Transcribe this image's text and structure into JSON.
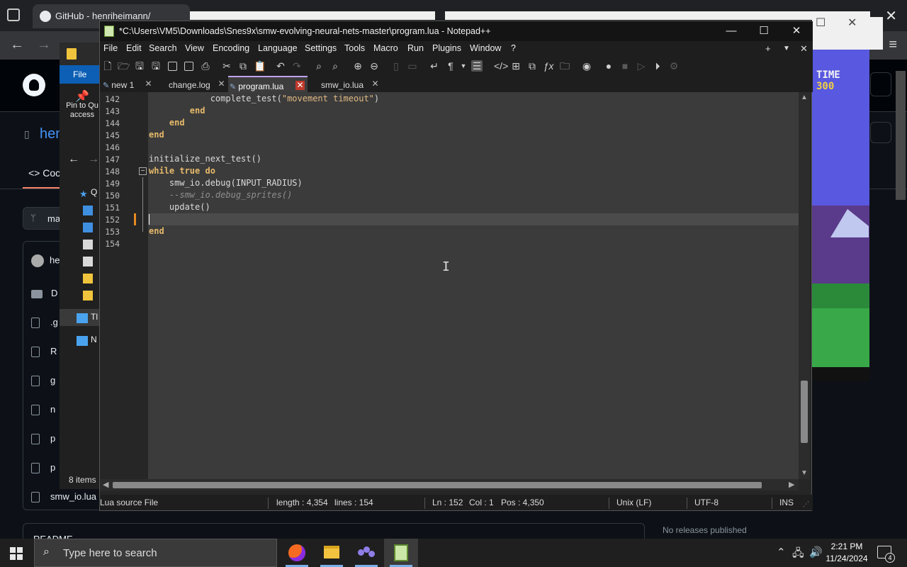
{
  "browser": {
    "tab_title": "GitHub - henriheimann/",
    "repo_name": "hen",
    "code_tab": "Code",
    "code_tab_visible": "Coc",
    "branch": "ma",
    "owner_avatar_text": "he",
    "files": [
      {
        "name": "D",
        "type": "folder"
      },
      {
        "name": ".g",
        "type": "file"
      },
      {
        "name": "R",
        "type": "file"
      },
      {
        "name": "g",
        "type": "file"
      },
      {
        "name": "n",
        "type": "file"
      },
      {
        "name": "p",
        "type": "file"
      },
      {
        "name": "p",
        "type": "file"
      },
      {
        "name": "smw_io.lua",
        "type": "file"
      }
    ],
    "readme_label": "README",
    "releases_text": "No releases published"
  },
  "explorer": {
    "ribbon_file_tab": "File",
    "pin_label_line1": "Pin to Qu",
    "pin_label_line2": "access",
    "nav_items": [
      {
        "label": "Q",
        "icon": "star-icon",
        "color": "#4aa3ef"
      },
      {
        "label": "",
        "icon": "desktop-icon",
        "color": "#3f8fe0"
      },
      {
        "label": "",
        "icon": "downloads-icon",
        "color": "#3f8fe0"
      },
      {
        "label": "",
        "icon": "documents-icon",
        "color": "#d8d8d8"
      },
      {
        "label": "",
        "icon": "pictures-icon",
        "color": "#d8d8d8"
      },
      {
        "label": "",
        "icon": "folder-icon",
        "color": "#f0c43c"
      },
      {
        "label": "",
        "icon": "folder-icon",
        "color": "#f0c43c"
      },
      {
        "label": "Tl",
        "icon": "this-pc-icon",
        "color": "#4aa3ef"
      },
      {
        "label": "N",
        "icon": "network-icon",
        "color": "#4aa3ef"
      }
    ],
    "status": "8 items"
  },
  "emulator": {
    "hud_line1": "TIME",
    "hud_line2": "300"
  },
  "npp": {
    "title": "*C:\\Users\\VM5\\Downloads\\Snes9x\\smw-evolving-neural-nets-master\\program.lua - Notepad++",
    "menu": [
      "File",
      "Edit",
      "Search",
      "View",
      "Encoding",
      "Language",
      "Settings",
      "Tools",
      "Macro",
      "Run",
      "Plugins",
      "Window",
      "?"
    ],
    "tabs": [
      {
        "label": "new 1",
        "active": false
      },
      {
        "label": "change.log",
        "active": false
      },
      {
        "label": "program.lua",
        "active": true
      },
      {
        "label": "smw_io.lua",
        "active": false
      }
    ],
    "lines": [
      {
        "num": "142",
        "indent": "            ",
        "parts": [
          {
            "t": "complete_test(",
            "c": ""
          },
          {
            "t": "\"movement timeout\"",
            "c": "str"
          },
          {
            "t": ")",
            "c": ""
          }
        ]
      },
      {
        "num": "143",
        "indent": "        ",
        "parts": [
          {
            "t": "end",
            "c": "kw"
          }
        ]
      },
      {
        "num": "144",
        "indent": "    ",
        "parts": [
          {
            "t": "end",
            "c": "kw"
          }
        ]
      },
      {
        "num": "145",
        "indent": "",
        "parts": [
          {
            "t": "end",
            "c": "kw"
          }
        ]
      },
      {
        "num": "146",
        "indent": "",
        "parts": []
      },
      {
        "num": "147",
        "indent": "",
        "parts": [
          {
            "t": "initialize_next_test()",
            "c": ""
          }
        ]
      },
      {
        "num": "148",
        "indent": "",
        "parts": [
          {
            "t": "while",
            "c": "kw"
          },
          {
            "t": " true ",
            "c": "kw"
          },
          {
            "t": "do",
            "c": "kw"
          }
        ]
      },
      {
        "num": "149",
        "indent": "    ",
        "parts": [
          {
            "t": "smw_io.debug(INPUT_RADIUS)",
            "c": ""
          }
        ]
      },
      {
        "num": "150",
        "indent": "    ",
        "parts": [
          {
            "t": "--smw_io.debug_sprites()",
            "c": "cm"
          }
        ]
      },
      {
        "num": "151",
        "indent": "    ",
        "parts": [
          {
            "t": "update()",
            "c": ""
          }
        ]
      },
      {
        "num": "152",
        "indent": "",
        "parts": []
      },
      {
        "num": "153",
        "indent": "",
        "parts": [
          {
            "t": "end",
            "c": "kw"
          }
        ]
      },
      {
        "num": "154",
        "indent": "",
        "parts": []
      }
    ],
    "status": {
      "file_type": "Lua source File",
      "length": "length : 4,354",
      "lines": "lines : 154",
      "ln": "Ln : 152",
      "col": "Col : 1",
      "pos": "Pos : 4,350",
      "eol": "Unix (LF)",
      "encoding": "UTF-8",
      "mode": "INS"
    }
  },
  "taskbar": {
    "search_placeholder": "Type here to search",
    "time": "2:21 PM",
    "date": "11/24/2024",
    "notification_count": "4"
  }
}
